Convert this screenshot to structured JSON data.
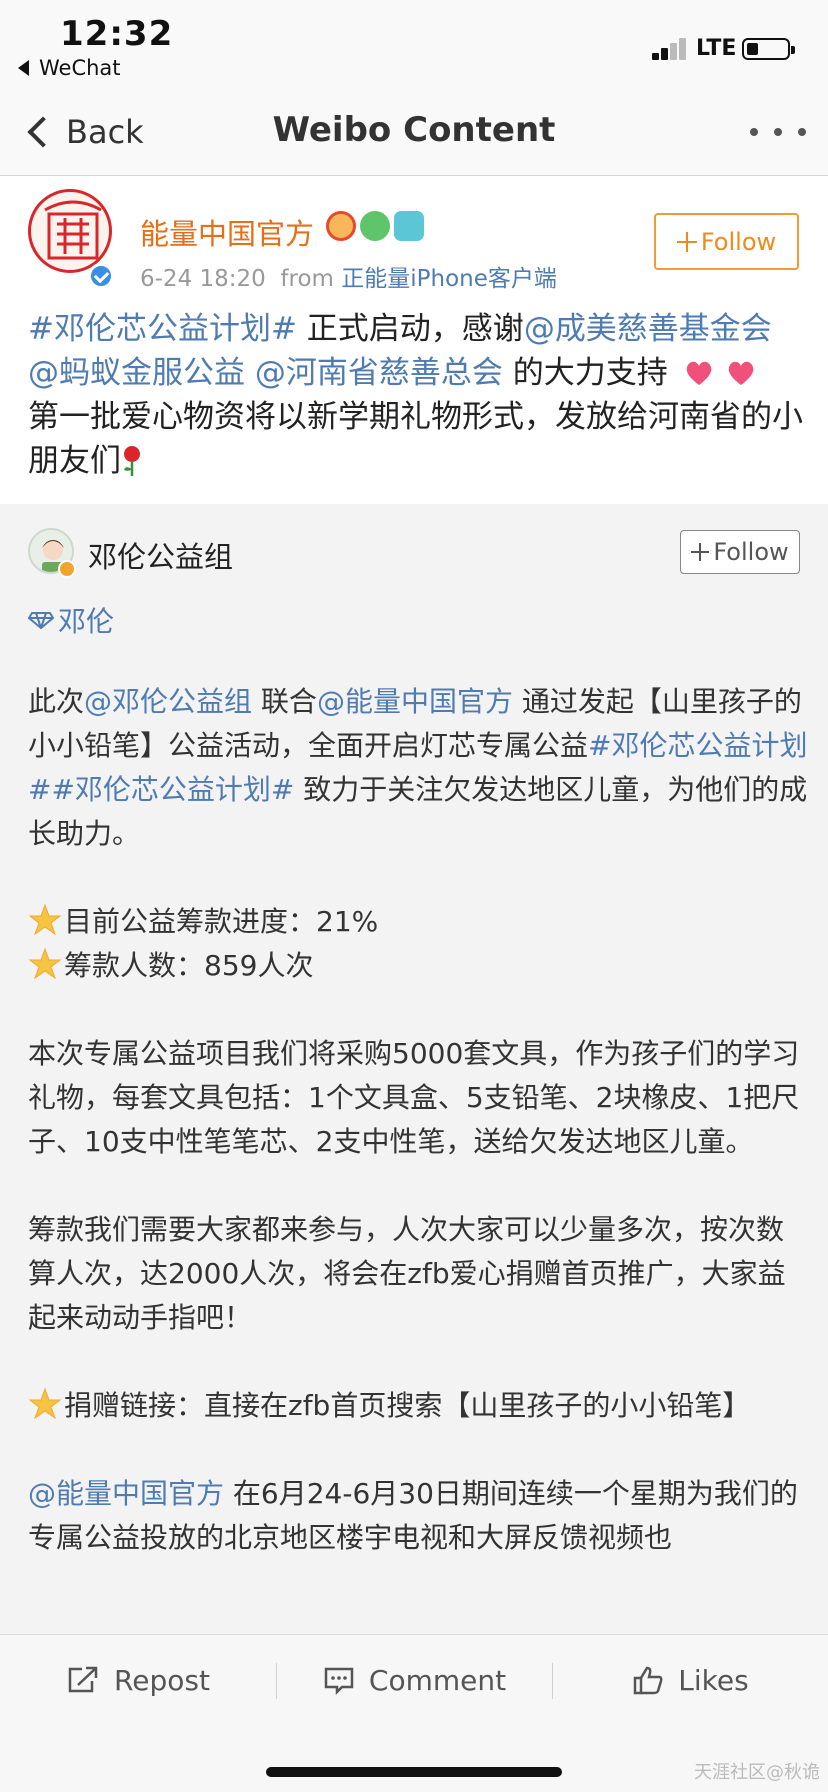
{
  "status_bar": {
    "time": "12:32",
    "back_app": "WeChat",
    "network": "LTE"
  },
  "nav": {
    "back_label": "Back",
    "title": "Weibo Content"
  },
  "post": {
    "author": "能量中国官方",
    "date": "6-24 18:20",
    "from_label": "from",
    "source": "正能量iPhone客户端",
    "follow_label": "Follow",
    "text": {
      "topic": "#邓伦芯公益计划#",
      "t1": " 正式启动，感谢",
      "mention1": "@成美慈善基金会",
      "mention2": "@蚂蚁金服公益",
      "mention3": "@河南省慈善总会",
      "t2": " 的大力支持",
      "t3": "第一批爱心物资将以新学期礼物形式，发放给河南省的小朋友们"
    }
  },
  "repost": {
    "author": "邓伦公益组",
    "follow_label": "Follow",
    "topic_tag": "邓伦",
    "p1": {
      "t1": "此次",
      "mention1": "@邓伦公益组",
      "t2": " 联合",
      "mention2": "@能量中国官方",
      "t3": " 通过发起【山里孩子的小小铅笔】公益活动，全面开启灯芯专属公益",
      "topic1": "#邓伦芯公益计划#",
      "topic2": "#邓伦芯公益计划#",
      "t4": " 致力于关注欠发达地区儿童，为他们的成长助力。"
    },
    "progress": "目前公益筹款进度：21%",
    "donors": "筹款人数：859人次",
    "p3": "本次专属公益项目我们将采购5000套文具，作为孩子们的学习礼物，每套文具包括：1个文具盒、5支铅笔、2块橡皮、1把尺子、10支中性笔笔芯、2支中性笔，送给欠发达地区儿童。",
    "p4": "筹款我们需要大家都来参与，人次大家可以少量多次，按次数算人次，达2000人次，将会在zfb爱心捐赠首页推广，大家益起来动动手指吧！",
    "p5": "捐赠链接：直接在zfb首页搜索【山里孩子的小小铅笔】",
    "p6": {
      "mention": "@能量中国官方",
      "t1": " 在6月24-6月30日期间连续一个星期为我们的专属公益投放的北京地区楼宇电视和大屏反馈视频也"
    }
  },
  "actions": {
    "repost": "Repost",
    "comment": "Comment",
    "likes": "Likes"
  },
  "watermark": "天涯社区@秋诡",
  "colors": {
    "accent_orange": "#e86d17",
    "link_blue": "#4f7bb3",
    "follow_border": "#f19a36"
  }
}
